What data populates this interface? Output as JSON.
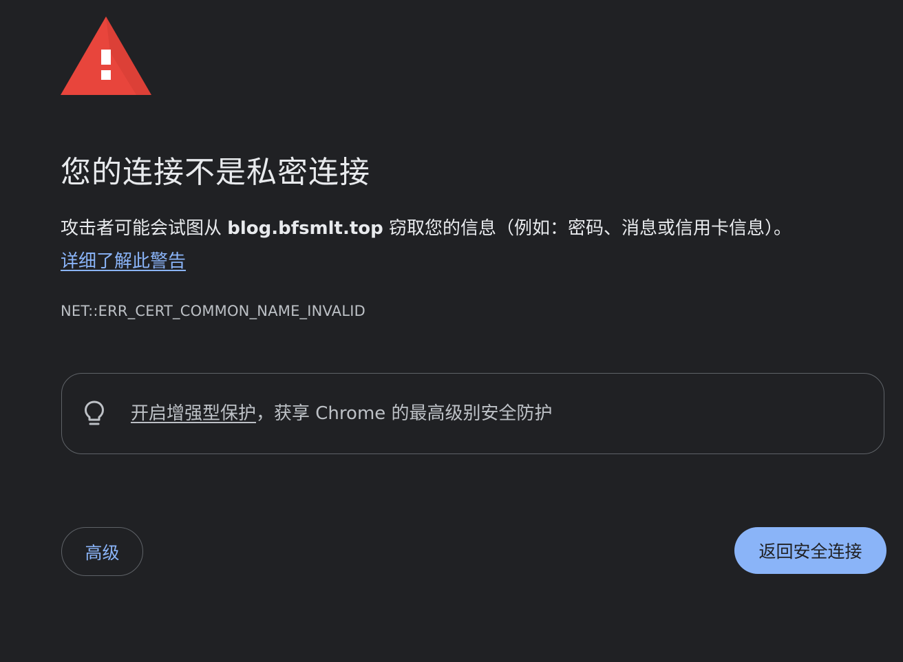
{
  "interstitial": {
    "title": "您的连接不是私密连接",
    "message_prefix": "攻击者可能会试图从 ",
    "host": "blog.bfsmlt.top",
    "message_suffix": " 窃取您的信息（例如：密码、消息或信用卡信息）。",
    "learn_more_link": "详细了解此警告",
    "error_code": "NET::ERR_CERT_COMMON_NAME_INVALID"
  },
  "enhanced_protection": {
    "icon": "lightbulb-icon",
    "link_text": "开启增强型保护",
    "suffix_text": "，获享 Chrome 的最高级别安全防护"
  },
  "buttons": {
    "advanced_label": "高级",
    "back_to_safety_label": "返回安全连接"
  },
  "colors": {
    "background": "#202124",
    "warning_red": "#e8453c",
    "accent_blue": "#8ab4f8",
    "text_primary": "#e8eaed",
    "text_secondary": "#bdc1c6"
  }
}
